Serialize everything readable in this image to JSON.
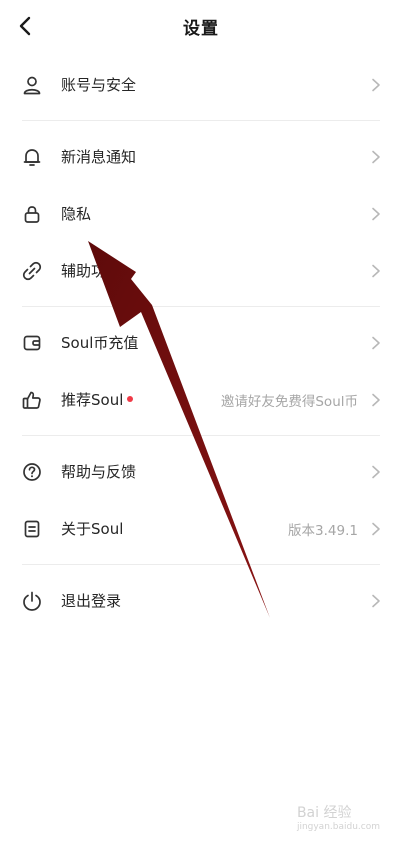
{
  "header": {
    "title": "设置"
  },
  "settings": {
    "account": {
      "label": "账号与安全",
      "icon": "user-icon"
    },
    "notifications": {
      "label": "新消息通知",
      "icon": "bell-icon"
    },
    "privacy": {
      "label": "隐私",
      "icon": "lock-icon"
    },
    "accessibility": {
      "label": "辅助功能",
      "icon": "link-icon"
    },
    "soul_coin": {
      "label": "Soul币充值",
      "icon": "wallet-icon"
    },
    "recommend": {
      "label": "推荐Soul",
      "value": "邀请好友免费得Soul币",
      "icon": "thumbs-up-icon"
    },
    "help": {
      "label": "帮助与反馈",
      "icon": "question-icon"
    },
    "about": {
      "label": "关于Soul",
      "value": "版本3.49.1",
      "icon": "document-icon"
    },
    "logout": {
      "label": "退出登录",
      "icon": "power-icon"
    }
  },
  "colors": {
    "annotation_arrow": "#7a0f0f",
    "badge": "#f03a47",
    "secondary_text": "#a6a6a6"
  },
  "watermark": {
    "text": "Bai 经验",
    "sub": "jingyan.baidu.com"
  }
}
